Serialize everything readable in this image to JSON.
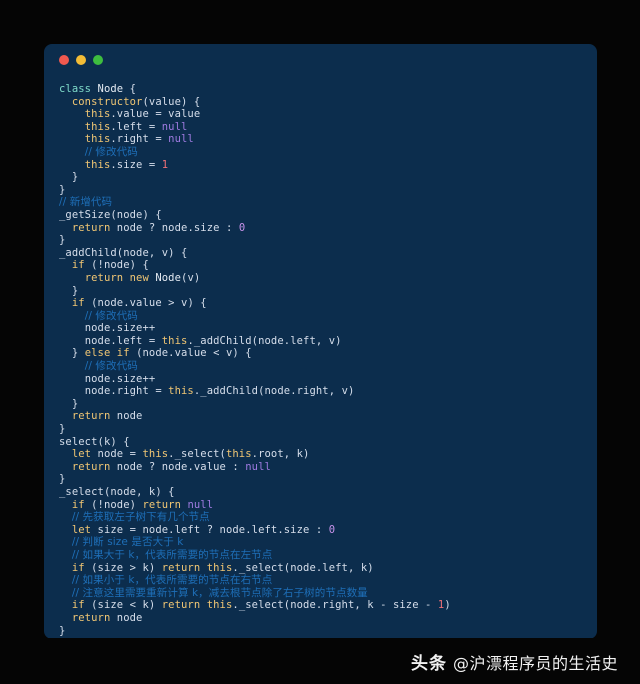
{
  "window": {
    "traffic_lights": [
      {
        "name": "close-button",
        "color": "#f1594f"
      },
      {
        "name": "minimize-button",
        "color": "#f3bc36"
      },
      {
        "name": "maximize-button",
        "color": "#3ebd3f"
      }
    ],
    "background_color": "#0c2d4d",
    "page_background_color": "#050505"
  },
  "theme": {
    "keyword": "#f0c674",
    "class_keyword": "#7fdbca",
    "identifier": "#e5ebf3",
    "plain": "#d6deeb",
    "null_literal": "#9f7be1",
    "number": "#c792ea",
    "number_warm": "#f07178",
    "comment": "#1e6fb8"
  },
  "code": {
    "language": "javascript",
    "lines": [
      "class Node {",
      "  constructor(value) {",
      "    this.value = value",
      "    this.left = null",
      "    this.right = null",
      "    // 修改代码",
      "    this.size = 1",
      "  }",
      "}",
      "// 新增代码",
      "_getSize(node) {",
      "  return node ? node.size : 0",
      "}",
      "_addChild(node, v) {",
      "  if (!node) {",
      "    return new Node(v)",
      "  }",
      "  if (node.value > v) {",
      "    // 修改代码",
      "    node.size++",
      "    node.left = this._addChild(node.left, v)",
      "  } else if (node.value < v) {",
      "    // 修改代码",
      "    node.size++",
      "    node.right = this._addChild(node.right, v)",
      "  }",
      "  return node",
      "}",
      "select(k) {",
      "  let node = this._select(this.root, k)",
      "  return node ? node.value : null",
      "}",
      "_select(node, k) {",
      "  if (!node) return null",
      "  // 先获取左子树下有几个节点",
      "  let size = node.left ? node.left.size : 0",
      "  // 判断 size 是否大于 k",
      "  // 如果大于 k，代表所需要的节点在左节点",
      "  if (size > k) return this._select(node.left, k)",
      "  // 如果小于 k，代表所需要的节点在右节点",
      "  // 注意这里需要重新计算 k，减去根节点除了右子树的节点数量",
      "  if (size < k) return this._select(node.right, k - size - 1)",
      "  return node",
      "}"
    ],
    "comments": [
      "// 修改代码",
      "// 新增代码",
      "// 先获取左子树下有几个节点",
      "// 判断 size 是否大于 k",
      "// 如果大于 k，代表所需要的节点在左节点",
      "// 如果小于 k，代表所需要的节点在右节点",
      "// 注意这里需要重新计算 k，减去根节点除了右子树的节点数量"
    ]
  },
  "footer": {
    "brand": "头条",
    "handle": "@沪漂程序员的生活史"
  }
}
